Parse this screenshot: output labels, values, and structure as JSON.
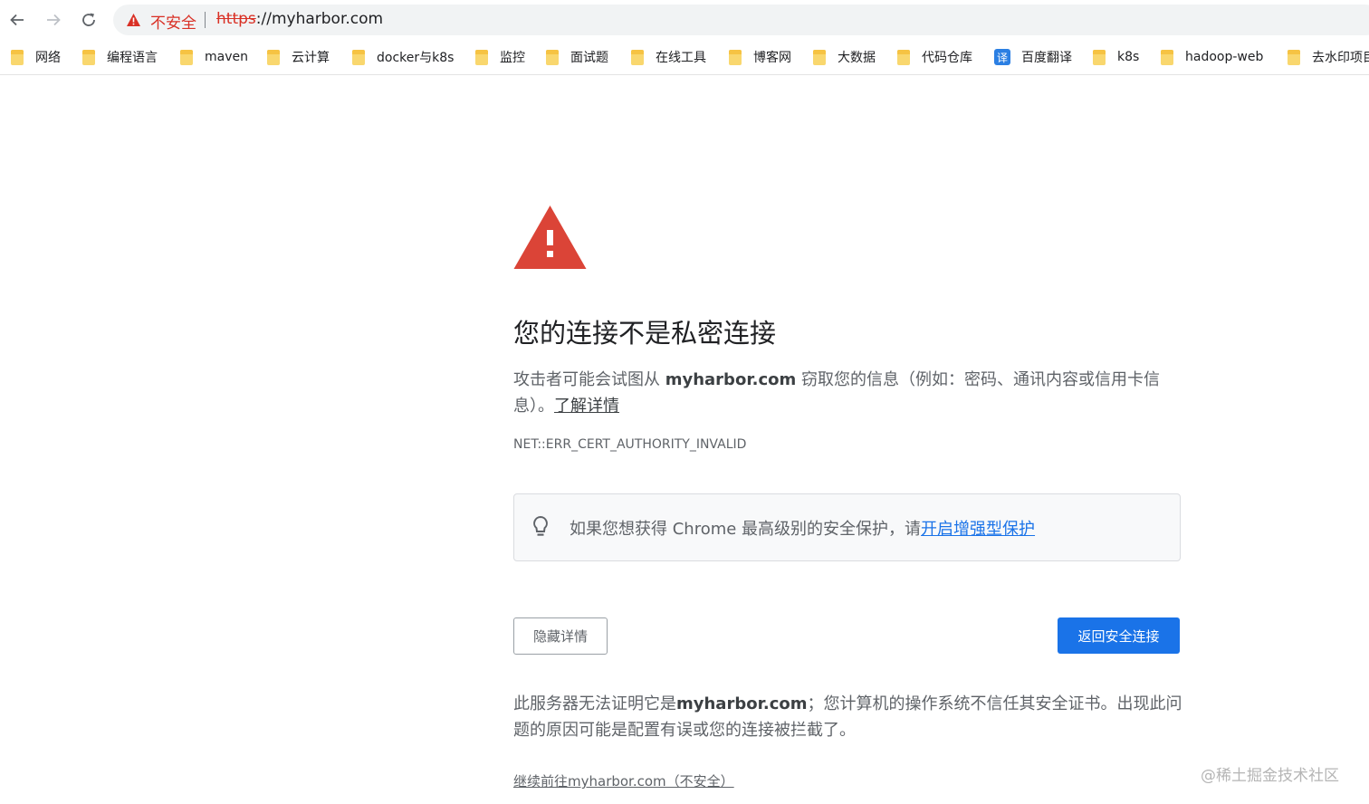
{
  "toolbar": {
    "security_label": "不安全",
    "url_scheme": "https",
    "url_rest": "://myharbor.com"
  },
  "bookmarks": [
    {
      "label": "网络",
      "icon": "folder-icon"
    },
    {
      "label": "编程语言",
      "icon": "folder-icon"
    },
    {
      "label": "maven",
      "icon": "folder-icon"
    },
    {
      "label": "云计算",
      "icon": "folder-icon"
    },
    {
      "label": "docker与k8s",
      "icon": "folder-icon"
    },
    {
      "label": "监控",
      "icon": "folder-icon"
    },
    {
      "label": "面试题",
      "icon": "folder-icon"
    },
    {
      "label": "在线工具",
      "icon": "folder-icon"
    },
    {
      "label": "博客网",
      "icon": "folder-icon"
    },
    {
      "label": "大数据",
      "icon": "folder-icon"
    },
    {
      "label": "代码仓库",
      "icon": "folder-icon"
    },
    {
      "label": "百度翻译",
      "icon": "translate-icon",
      "icon_text": "译"
    },
    {
      "label": "k8s",
      "icon": "folder-icon"
    },
    {
      "label": "hadoop-web",
      "icon": "folder-icon"
    },
    {
      "label": "去水印项目",
      "icon": "folder-icon"
    }
  ],
  "interstitial": {
    "heading": "您的连接不是私密连接",
    "para_prefix": "攻击者可能会试图从 ",
    "para_host": "myharbor.com",
    "para_suffix": " 窃取您的信息（例如：密码、通讯内容或信用卡信息）。",
    "learn_more": "了解详情",
    "error_code": "NET::ERR_CERT_AUTHORITY_INVALID",
    "tip_text": "如果您想获得 Chrome 最高级别的安全保护，请",
    "tip_link": "开启增强型保护",
    "details_button": "隐藏详情",
    "back_button": "返回安全连接",
    "detail_prefix": "此服务器无法证明它是",
    "detail_host": "myharbor.com",
    "detail_suffix": "；您计算机的操作系统不信任其安全证书。出现此问题的原因可能是配置有误或您的连接被拦截了。",
    "proceed_link": "继续前往myharbor.com（不安全）"
  },
  "watermark": "@稀土掘金技术社区",
  "colors": {
    "danger": "#d93025",
    "link": "#1a73e8",
    "folder": "#f9d76e"
  }
}
